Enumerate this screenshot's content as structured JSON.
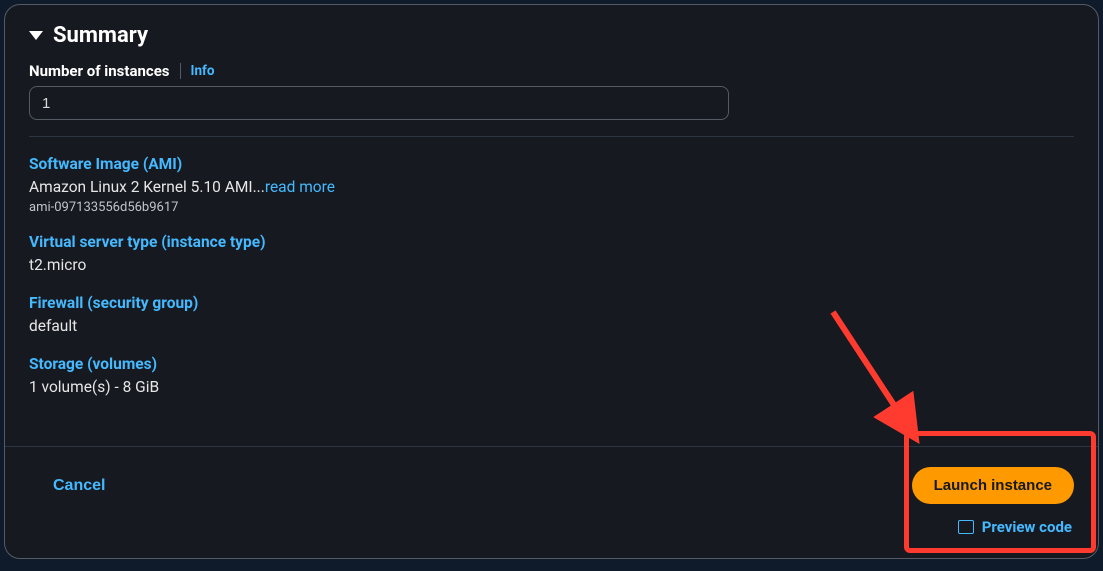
{
  "summary": {
    "title": "Summary",
    "instances_label": "Number of instances",
    "info_link": "Info",
    "instances_value": "1"
  },
  "sections": {
    "ami": {
      "heading": "Software Image (AMI)",
      "line": "Amazon Linux 2 Kernel 5.10 AMI...",
      "read_more": "read more",
      "id": "ami-097133556d56b9617"
    },
    "instance_type": {
      "heading": "Virtual server type (instance type)",
      "value": "t2.micro"
    },
    "firewall": {
      "heading": "Firewall (security group)",
      "value": "default"
    },
    "storage": {
      "heading": "Storage (volumes)",
      "value": "1 volume(s) - 8 GiB"
    }
  },
  "footer": {
    "cancel": "Cancel",
    "launch": "Launch instance",
    "preview": "Preview code"
  }
}
